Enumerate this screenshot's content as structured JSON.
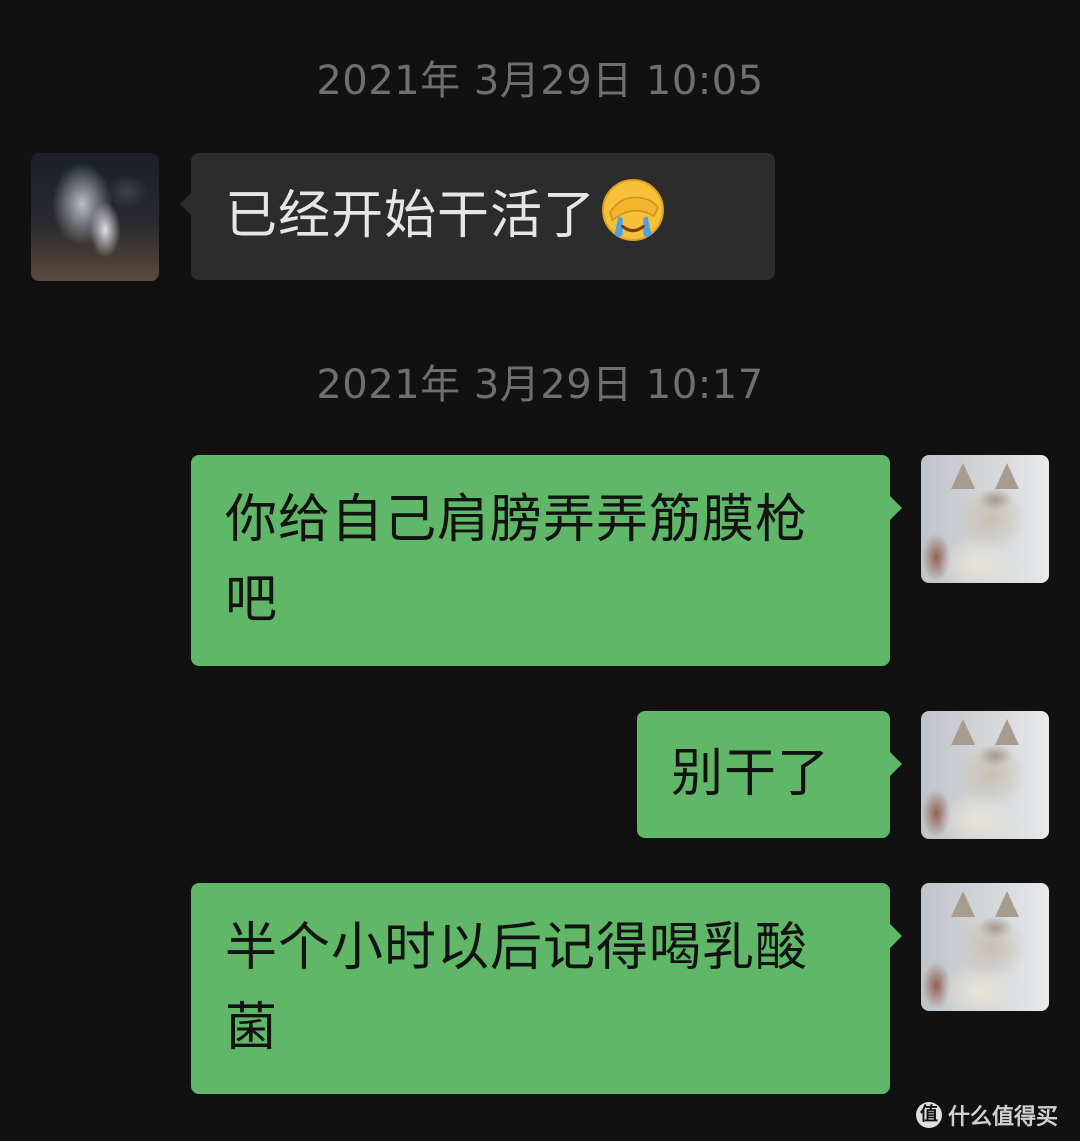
{
  "messages": [
    {
      "type": "timestamp",
      "text": "2021年 3月29日 10:05"
    },
    {
      "type": "incoming",
      "text": "已经开始干活了",
      "emoji": "face-palm-crying-emoji"
    },
    {
      "type": "timestamp",
      "text": "2021年 3月29日 10:17"
    },
    {
      "type": "outgoing",
      "text": "你给自己肩膀弄弄筋膜枪吧"
    },
    {
      "type": "outgoing",
      "text": "别干了"
    },
    {
      "type": "outgoing",
      "text": "半个小时以后记得喝乳酸菌"
    }
  ],
  "watermark": {
    "logo": "值",
    "text": "什么值得买"
  },
  "colors": {
    "background": "#111111",
    "incoming_bubble": "#2c2c2c",
    "outgoing_bubble": "#5fb767",
    "timestamp": "#6f6f6f"
  },
  "icons": {
    "incoming_avatar": "fireworks-person-avatar",
    "outgoing_avatar": "maine-coon-cat-avatar"
  }
}
